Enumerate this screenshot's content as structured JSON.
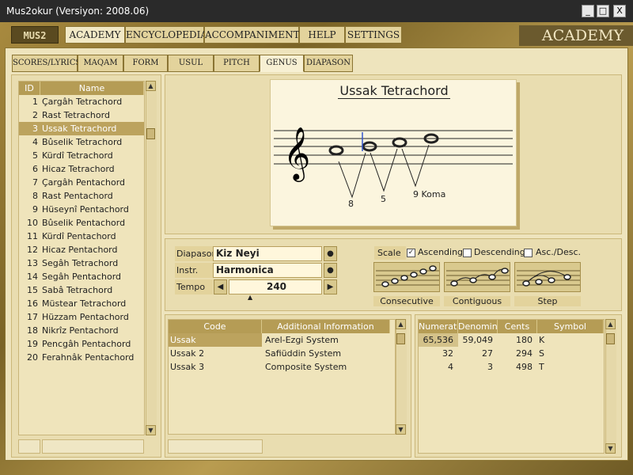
{
  "window": {
    "title": "Mus2okur  (Versiyon: 2008.06)",
    "controls": [
      "_",
      "□",
      "X"
    ]
  },
  "app": {
    "logo_text": "MUS2",
    "banner": "ACADEMY",
    "main_tabs": [
      "ACADEMY",
      "ENCYCLOPEDIA",
      "ACCOMPANIMENT",
      "HELP",
      "SETTINGS"
    ],
    "sub_tabs": [
      "SCORES/LYRICS",
      "MAQAM",
      "FORM",
      "USUL",
      "PITCH",
      "GENUS",
      "DIAPASON"
    ]
  },
  "genus_list": {
    "columns": [
      "ID",
      "Name"
    ],
    "rows": [
      {
        "id": "1",
        "name": "Çargâh Tetrachord"
      },
      {
        "id": "2",
        "name": "Rast Tetrachord"
      },
      {
        "id": "3",
        "name": "Ussak Tetrachord"
      },
      {
        "id": "4",
        "name": "Bûselik Tetrachord"
      },
      {
        "id": "5",
        "name": "Kürdî Tetrachord"
      },
      {
        "id": "6",
        "name": "Hicaz Tetrachord"
      },
      {
        "id": "7",
        "name": "Çargâh Pentachord"
      },
      {
        "id": "8",
        "name": "Rast Pentachord"
      },
      {
        "id": "9",
        "name": "Hüseynî Pentachord"
      },
      {
        "id": "10",
        "name": "Bûselik Pentachord"
      },
      {
        "id": "11",
        "name": "Kürdî Pentachord"
      },
      {
        "id": "12",
        "name": "Hicaz Pentachord"
      },
      {
        "id": "13",
        "name": "Segâh Tetrachord"
      },
      {
        "id": "14",
        "name": "Segâh Pentachord"
      },
      {
        "id": "15",
        "name": "Sabâ Tetrachord"
      },
      {
        "id": "16",
        "name": "Müstear Tetrachord"
      },
      {
        "id": "17",
        "name": "Hüzzam Pentachord"
      },
      {
        "id": "18",
        "name": "Nikrîz Pentachord"
      },
      {
        "id": "19",
        "name": "Pencgâh Pentachord"
      },
      {
        "id": "20",
        "name": "Ferahnâk Pentachord"
      }
    ],
    "selected_index": 2
  },
  "notation": {
    "title": "Ussak Tetrachord",
    "intervals": [
      "8",
      "5",
      "9 Koma"
    ]
  },
  "controls": {
    "diapason_label": "Diapason",
    "diapason_value": "Kiz Neyi",
    "instr_label": "Instr.",
    "instr_value": "Harmonica",
    "tempo_label": "Tempo",
    "tempo_value": "240"
  },
  "scale": {
    "label": "Scale",
    "ascending": {
      "label": "Ascending",
      "checked": true
    },
    "descending": {
      "label": "Descending",
      "checked": false
    },
    "ascdesc": {
      "label": "Asc./Desc.",
      "checked": false
    },
    "modes": [
      "Consecutive",
      "Contiguous",
      "Step"
    ]
  },
  "code_table": {
    "columns": [
      "Code",
      "Additional Information"
    ],
    "rows": [
      {
        "code": "Ussak",
        "info": "Arel-Ezgi System"
      },
      {
        "code": "Ussak 2",
        "info": "Safiüddin System"
      },
      {
        "code": "Ussak 3",
        "info": "Composite System"
      }
    ]
  },
  "ratio_table": {
    "columns": [
      "Numerato",
      "Denomina",
      "Cents",
      "Symbol"
    ],
    "rows": [
      {
        "num": "65,536",
        "den": "59,049",
        "cents": "180",
        "sym": "K"
      },
      {
        "num": "32",
        "den": "27",
        "cents": "294",
        "sym": "S"
      },
      {
        "num": "4",
        "den": "3",
        "cents": "498",
        "sym": "T"
      }
    ]
  }
}
